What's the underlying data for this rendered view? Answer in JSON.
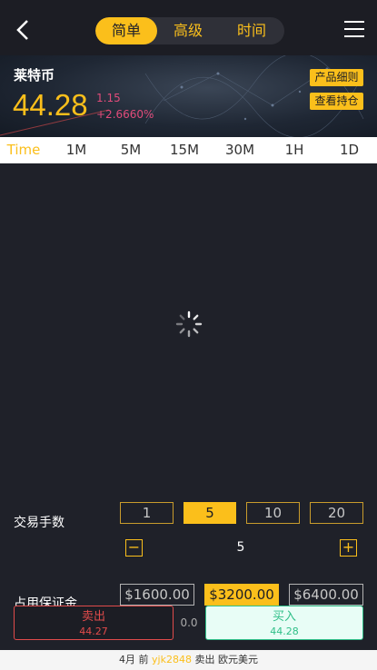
{
  "nav": {
    "tabs": [
      {
        "label": "简单",
        "active": true
      },
      {
        "label": "高级",
        "active": false
      },
      {
        "label": "时间",
        "active": false
      }
    ],
    "back_icon": "chevron-left-icon",
    "menu_icon": "hamburger-menu-icon"
  },
  "banner": {
    "name": "莱特币",
    "price": "44.28",
    "change": "1.15",
    "change_pct": "+2.6660%",
    "product_details": "产品细则",
    "view_positions": "查看持仓"
  },
  "periods": [
    "Time",
    "1M",
    "5M",
    "15M",
    "30M",
    "1H",
    "1D"
  ],
  "trade": {
    "lots_label": "交易手数",
    "lot_options": [
      "1",
      "5",
      "10",
      "20"
    ],
    "lot_selected": "5",
    "quantity": "5",
    "margin_label": "占用保证金",
    "margin_options": [
      "$1600.00",
      "$3200.00",
      "$6400.00"
    ],
    "margin_selected": "$3200.00"
  },
  "actions": {
    "sell_label": "卖出",
    "sell_price": "44.27",
    "spread": "0.0",
    "buy_label": "买入",
    "buy_price": "44.28"
  },
  "ticker": {
    "time": "4月 前",
    "user": "yjk2848",
    "action": "卖出",
    "product": "欧元美元"
  },
  "colors": {
    "accent": "#fbbf1b",
    "sell": "#e14b4b",
    "buy": "#2fbf88",
    "background": "#1f2129"
  }
}
